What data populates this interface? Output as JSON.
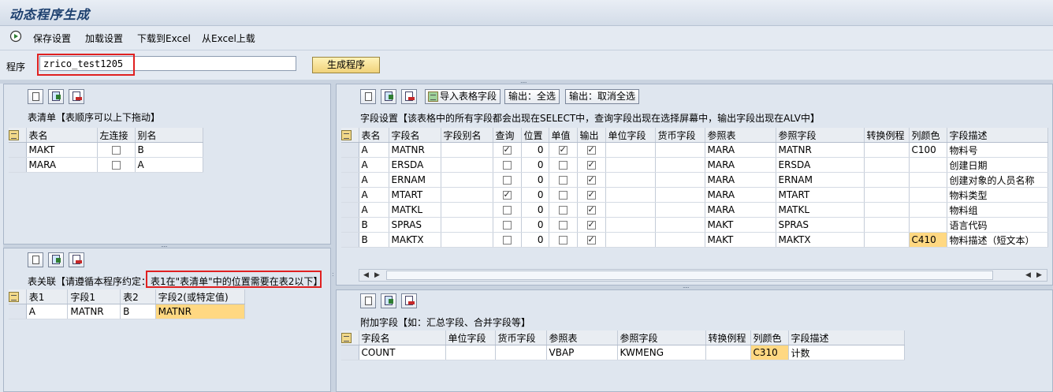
{
  "window": {
    "title": "动态程序生成"
  },
  "toolbar": {
    "items": [
      "保存设置",
      "加载设置",
      "下载到Excel",
      "从Excel上载"
    ]
  },
  "program": {
    "label": "程序",
    "value": "zrico_test1205",
    "generate_label": "生成程序"
  },
  "table_list": {
    "title": "表清单【表顺序可以上下拖动】",
    "columns": [
      "表名",
      "左连接",
      "别名"
    ],
    "rows": [
      {
        "table": "MAKT",
        "left_join": false,
        "alias": "B"
      },
      {
        "table": "MARA",
        "left_join": false,
        "alias": "A"
      }
    ]
  },
  "relations": {
    "title_prefix": "表关联【请遵循本程序约定：",
    "title_highlight": "表1在\"表清单\"中的位置需要在表2以下】",
    "columns": [
      "表1",
      "字段1",
      "表2",
      "字段2(或特定值)"
    ],
    "rows": [
      {
        "t1": "A",
        "f1": "MATNR",
        "t2": "B",
        "f2": "MATNR"
      }
    ]
  },
  "field_settings": {
    "buttons": [
      "导入表格字段",
      "输出：全选",
      "输出：取消全选"
    ],
    "title": "字段设置【该表格中的所有字段都会出现在SELECT中，查询字段出现在选择屏幕中，输出字段出现在ALV中】",
    "columns": [
      "表名",
      "字段名",
      "字段别名",
      "查询",
      "位置",
      "单值",
      "输出",
      "单位字段",
      "货币字段",
      "参照表",
      "参照字段",
      "转换例程",
      "列颜色",
      "字段描述"
    ],
    "rows": [
      {
        "table": "A",
        "field": "MATNR",
        "alias": "",
        "query": true,
        "pos": "0",
        "single": true,
        "output": true,
        "unit": "",
        "curr": "",
        "ref_table": "MARA",
        "ref_field": "MATNR",
        "conv": "",
        "color": "C100",
        "desc": "物料号"
      },
      {
        "table": "A",
        "field": "ERSDA",
        "alias": "",
        "query": false,
        "pos": "0",
        "single": false,
        "output": true,
        "unit": "",
        "curr": "",
        "ref_table": "MARA",
        "ref_field": "ERSDA",
        "conv": "",
        "color": "",
        "desc": "创建日期"
      },
      {
        "table": "A",
        "field": "ERNAM",
        "alias": "",
        "query": false,
        "pos": "0",
        "single": false,
        "output": true,
        "unit": "",
        "curr": "",
        "ref_table": "MARA",
        "ref_field": "ERNAM",
        "conv": "",
        "color": "",
        "desc": "创建对象的人员名称"
      },
      {
        "table": "A",
        "field": "MTART",
        "alias": "",
        "query": true,
        "pos": "0",
        "single": false,
        "output": true,
        "unit": "",
        "curr": "",
        "ref_table": "MARA",
        "ref_field": "MTART",
        "conv": "",
        "color": "",
        "desc": "物料类型"
      },
      {
        "table": "A",
        "field": "MATKL",
        "alias": "",
        "query": false,
        "pos": "0",
        "single": false,
        "output": true,
        "unit": "",
        "curr": "",
        "ref_table": "MARA",
        "ref_field": "MATKL",
        "conv": "",
        "color": "",
        "desc": "物料组"
      },
      {
        "table": "B",
        "field": "SPRAS",
        "alias": "",
        "query": false,
        "pos": "0",
        "single": false,
        "output": true,
        "unit": "",
        "curr": "",
        "ref_table": "MAKT",
        "ref_field": "SPRAS",
        "conv": "",
        "color": "",
        "desc": "语言代码"
      },
      {
        "table": "B",
        "field": "MAKTX",
        "alias": "",
        "query": false,
        "pos": "0",
        "single": false,
        "output": true,
        "unit": "",
        "curr": "",
        "ref_table": "MAKT",
        "ref_field": "MAKTX",
        "conv": "",
        "color": "C410",
        "desc": "物料描述（短文本）"
      }
    ]
  },
  "extra_fields": {
    "title": "附加字段【如：汇总字段、合并字段等】",
    "columns": [
      "字段名",
      "单位字段",
      "货币字段",
      "参照表",
      "参照字段",
      "转换例程",
      "列颜色",
      "字段描述"
    ],
    "rows": [
      {
        "field": "COUNT",
        "unit": "",
        "curr": "",
        "ref_table": "VBAP",
        "ref_field": "KWMENG",
        "conv": "",
        "color": "C310",
        "desc": "计数"
      }
    ]
  },
  "colors": {
    "highlight_cell": "#ffd882",
    "annotation_box": "#e02020"
  }
}
